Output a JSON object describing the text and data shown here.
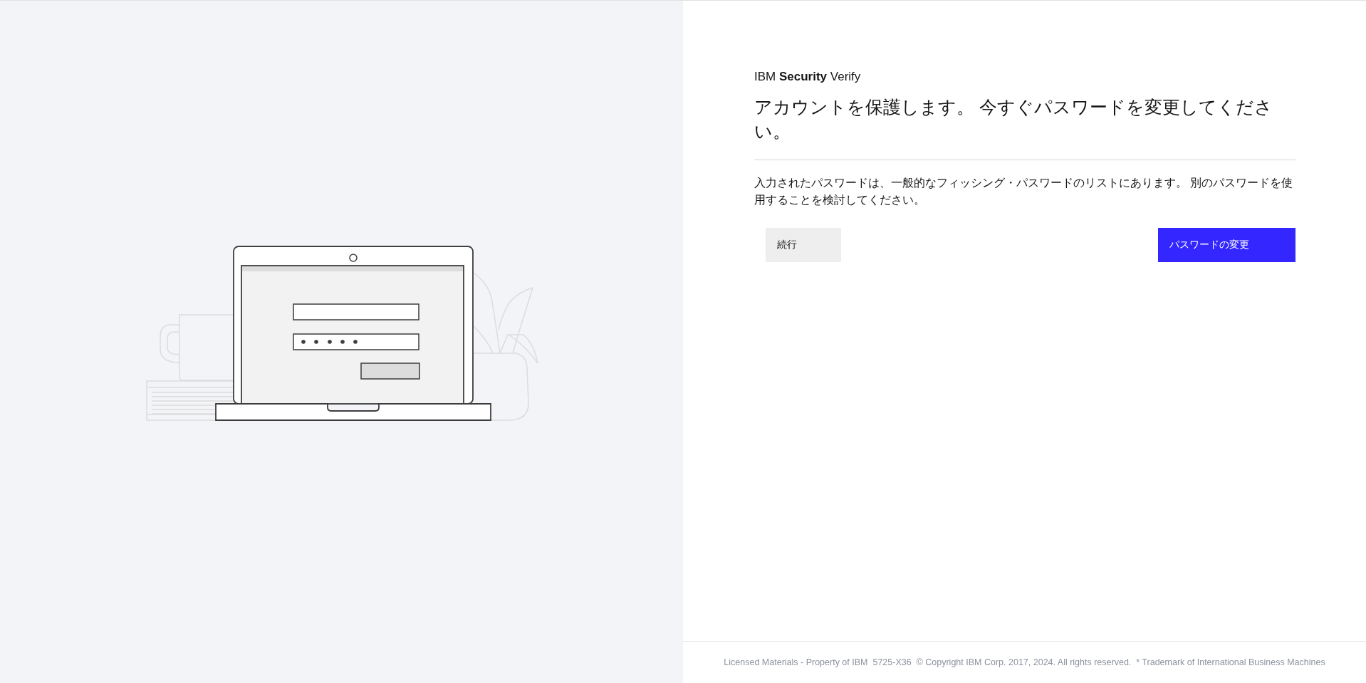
{
  "brand": {
    "logo": "IBM **Security** Verify"
  },
  "heading": "アカウントを保護します。 今すぐパスワードを変更してください。",
  "message": "入力されたパスワードは、一般的なフィッシング・パスワードのリストにあります。 別のパスワードを使用することを検討してください。",
  "buttons": [
    {
      "label": "続行",
      "kind": "secondary"
    },
    {
      "label": "パスワードの変更",
      "kind": "primary"
    }
  ],
  "footer": "Licensed Materials - Property of IBM  5725-X36  © Copyright IBM Corp. 2017, 2024. All rights reserved.  * Trademark of International Business Machines"
}
